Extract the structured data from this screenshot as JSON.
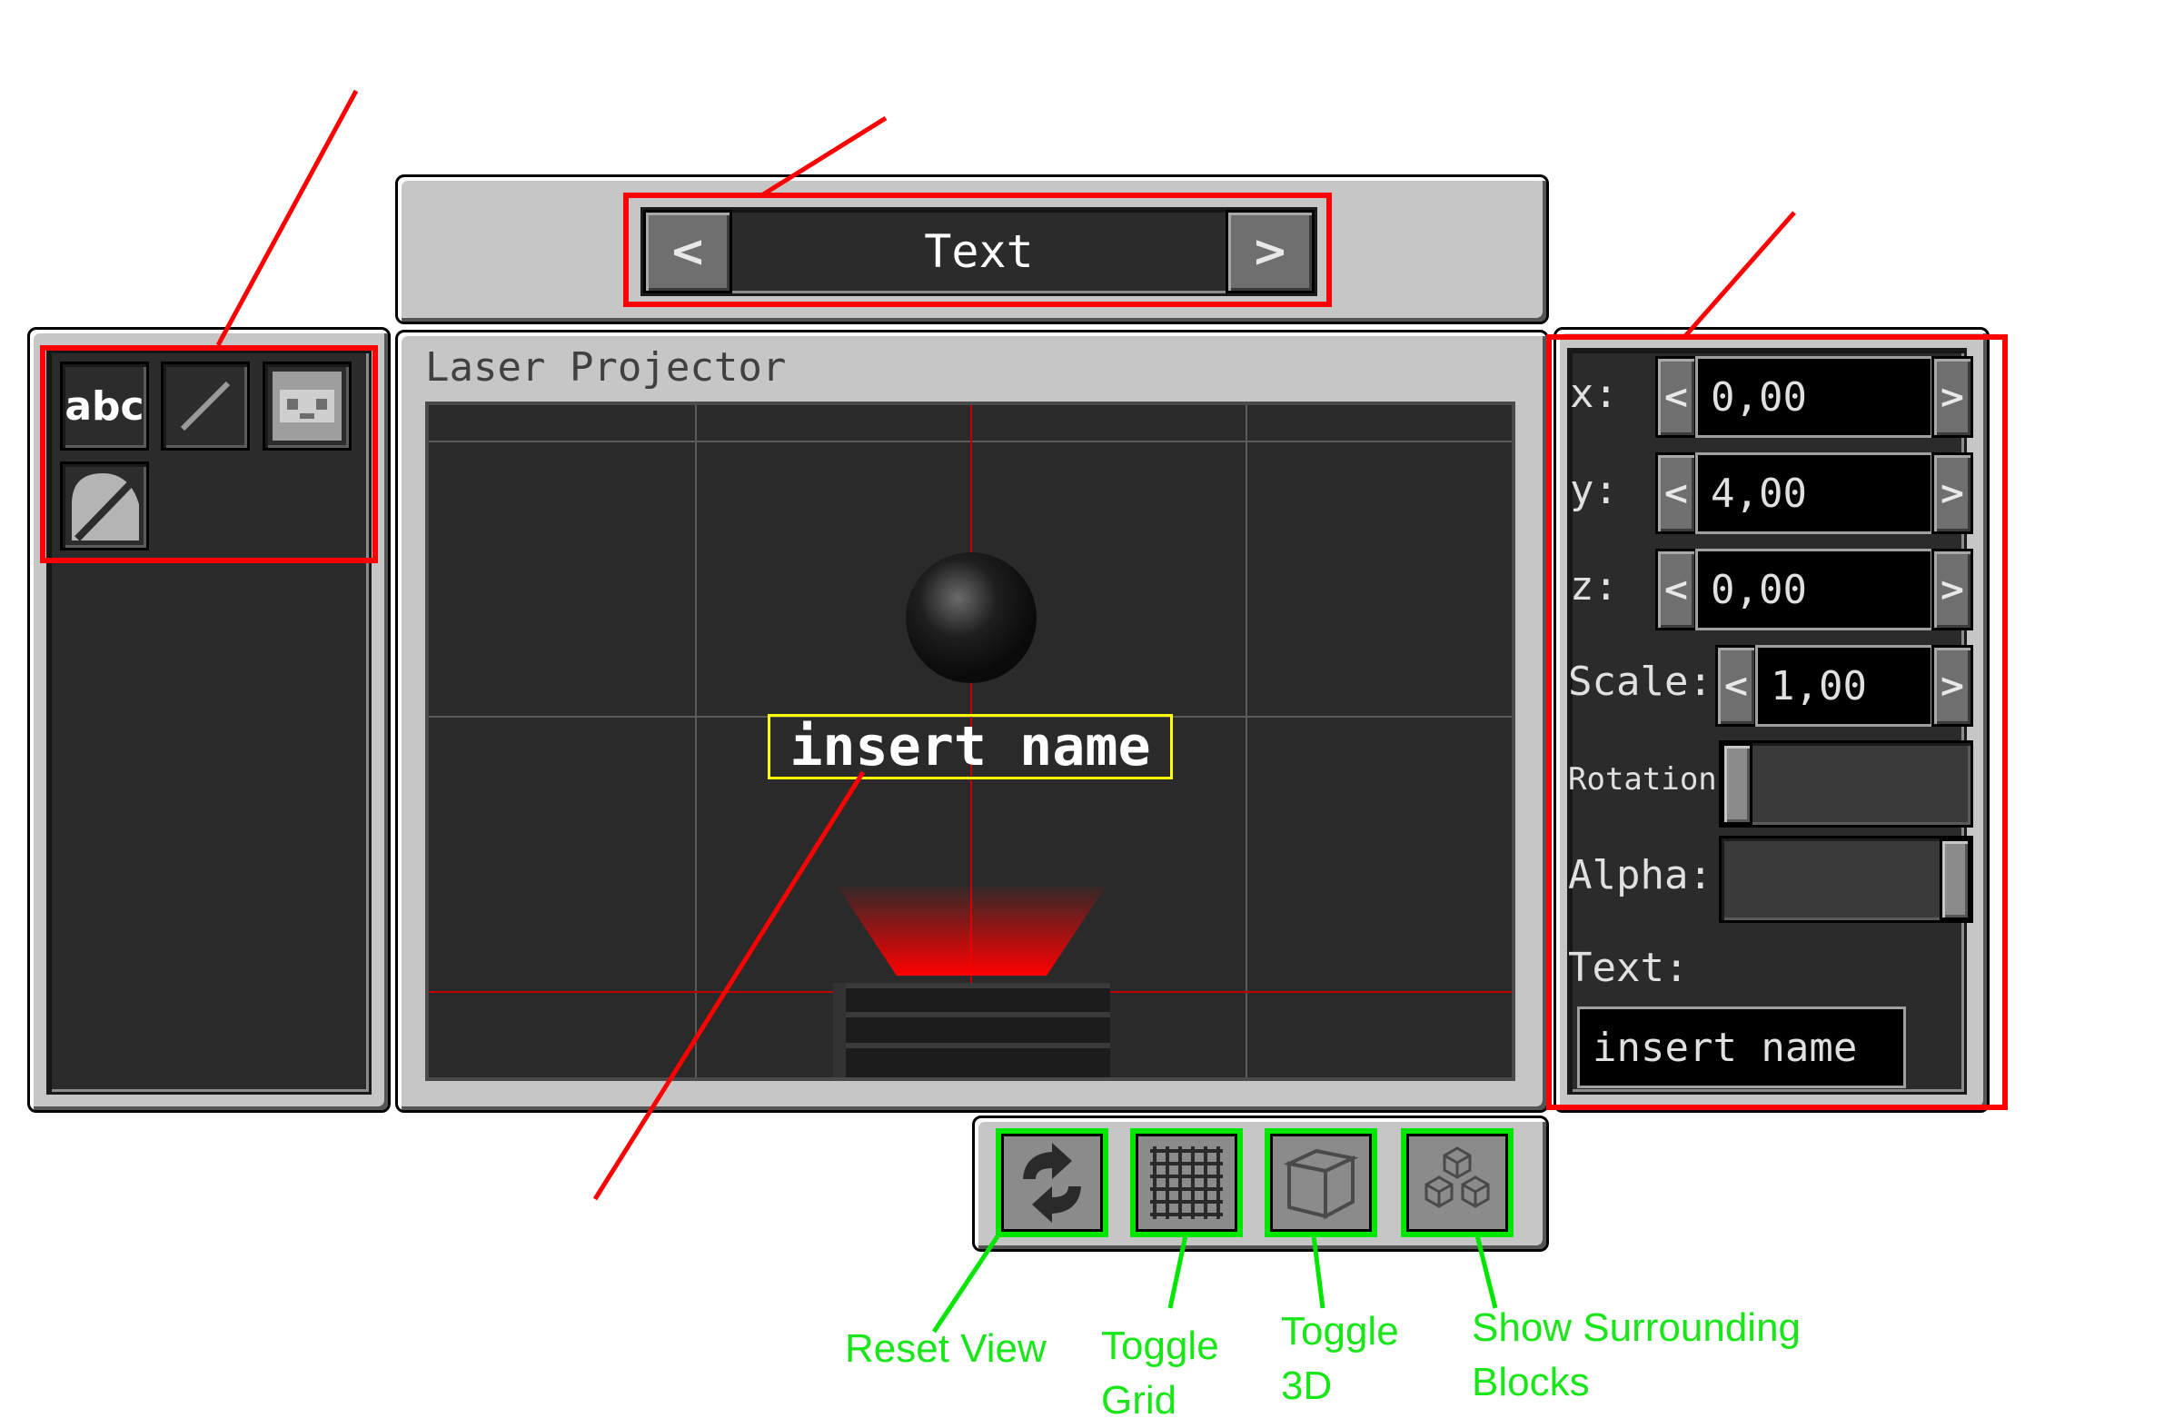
{
  "mode_selector": {
    "prev_label": "<",
    "value": "Text",
    "next_label": ">"
  },
  "projector": {
    "title": "Laser Projector",
    "preview_text": "insert name",
    "laser_color": "#ff0000"
  },
  "palette": {
    "items": [
      {
        "label": "abc",
        "icon": "text-icon"
      },
      {
        "label": "",
        "icon": "line-icon"
      },
      {
        "label": "",
        "icon": "image-icon"
      },
      {
        "label": "",
        "icon": "shape-icon"
      }
    ]
  },
  "properties": {
    "x": {
      "label": "x:",
      "value": "0,00"
    },
    "y": {
      "label": "y:",
      "value": "4,00"
    },
    "z": {
      "label": "z:",
      "value": "0,00"
    },
    "scale": {
      "label": "Scale:",
      "value": "1,00"
    },
    "rotation": {
      "label": "Rotation:",
      "level": 0.0
    },
    "alpha": {
      "label": "Alpha:",
      "level": 1.0
    },
    "text": {
      "label": "Text:",
      "value": "insert name"
    }
  },
  "toolbar": {
    "buttons": [
      {
        "icon": "reset-view-icon",
        "caption_lines": [
          "Reset View"
        ]
      },
      {
        "icon": "grid-icon",
        "caption_lines": [
          "Toggle",
          "Grid"
        ]
      },
      {
        "icon": "cube-icon",
        "caption_lines": [
          "Toggle",
          "3D"
        ]
      },
      {
        "icon": "blocks-icon",
        "caption_lines": [
          "Show Surrounding",
          "Blocks"
        ]
      }
    ]
  },
  "colors": {
    "callout_red": "#ff0000",
    "callout_green": "#00e600",
    "highlight_yellow": "#ffff00"
  }
}
